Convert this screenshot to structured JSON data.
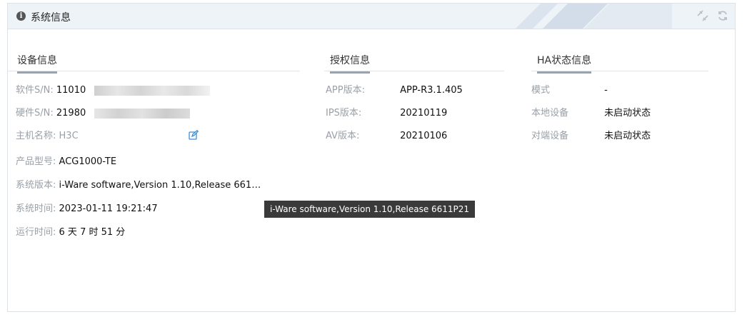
{
  "header": {
    "title": "系统信息",
    "info_icon": "info-icon",
    "tools": [
      "unlink-icon",
      "refresh-icon"
    ]
  },
  "device": {
    "section_title": "设备信息",
    "software_sn": {
      "label": "软件S/N:",
      "value": "11010"
    },
    "hardware_sn": {
      "label": "硬件S/N:",
      "value": "21980"
    },
    "hostname": {
      "label": "主机名称:",
      "value": "H3C"
    },
    "model": {
      "label": "产品型号:",
      "value": "ACG1000-TE"
    },
    "sys_version": {
      "label": "系统版本:",
      "value": "i-Ware software,Version 1.10,Release 661…"
    },
    "sys_time": {
      "label": "系统时间:",
      "value": "2023-01-11 19:21:47"
    },
    "uptime": {
      "label": "运行时间:",
      "value": "6 天 7 时 51 分"
    }
  },
  "license": {
    "section_title": "授权信息",
    "app_version": {
      "label": "APP版本:",
      "value": "APP-R3.1.405"
    },
    "ips_version": {
      "label": "IPS版本:",
      "value": "20210119"
    },
    "av_version": {
      "label": "AV版本:",
      "value": "20210106"
    }
  },
  "ha": {
    "section_title": "HA状态信息",
    "mode": {
      "label": "模式",
      "value": "-"
    },
    "local_device": {
      "label": "本地设备",
      "value": "未启动状态"
    },
    "peer_device": {
      "label": "对端设备",
      "value": "未启动状态"
    }
  },
  "tooltip": {
    "text": "i-Ware software,Version 1.10,Release 6611P21"
  },
  "colors": {
    "header_bg": "#eef3f8",
    "tooltip_bg": "#3a3a3a",
    "edit_icon": "#3a8fd8"
  }
}
